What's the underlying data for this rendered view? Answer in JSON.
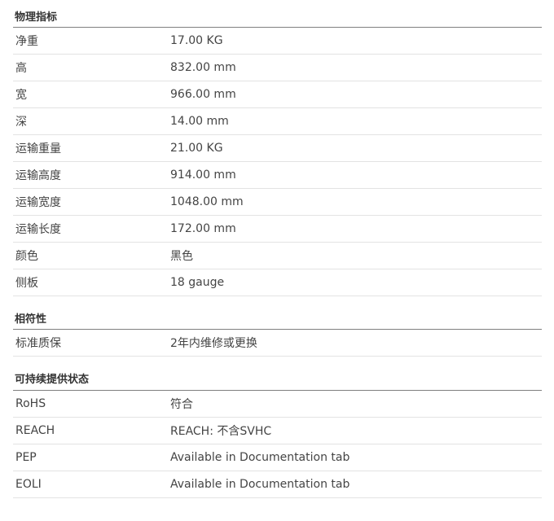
{
  "sections": [
    {
      "title": "物理指标",
      "rows": [
        {
          "label": "净重",
          "value": "17.00 KG"
        },
        {
          "label": "高",
          "value": "832.00 mm"
        },
        {
          "label": "宽",
          "value": "966.00 mm"
        },
        {
          "label": "深",
          "value": "14.00 mm"
        },
        {
          "label": "运输重量",
          "value": "21.00 KG"
        },
        {
          "label": "运输高度",
          "value": "914.00 mm"
        },
        {
          "label": "运输宽度",
          "value": "1048.00 mm"
        },
        {
          "label": "运输长度",
          "value": "172.00 mm"
        },
        {
          "label": "颜色",
          "value": "黑色"
        },
        {
          "label": "侧板",
          "value": "18 gauge"
        }
      ]
    },
    {
      "title": "相符性",
      "rows": [
        {
          "label": "标准质保",
          "value": "2年内维修或更换"
        }
      ]
    },
    {
      "title": "可持续提供状态",
      "rows": [
        {
          "label": "RoHS",
          "value": "符合"
        },
        {
          "label": "REACH",
          "value": "REACH: 不含SVHC"
        },
        {
          "label": "PEP",
          "value": "Available in Documentation tab"
        },
        {
          "label": "EOLI",
          "value": "Available in Documentation tab"
        }
      ]
    }
  ]
}
